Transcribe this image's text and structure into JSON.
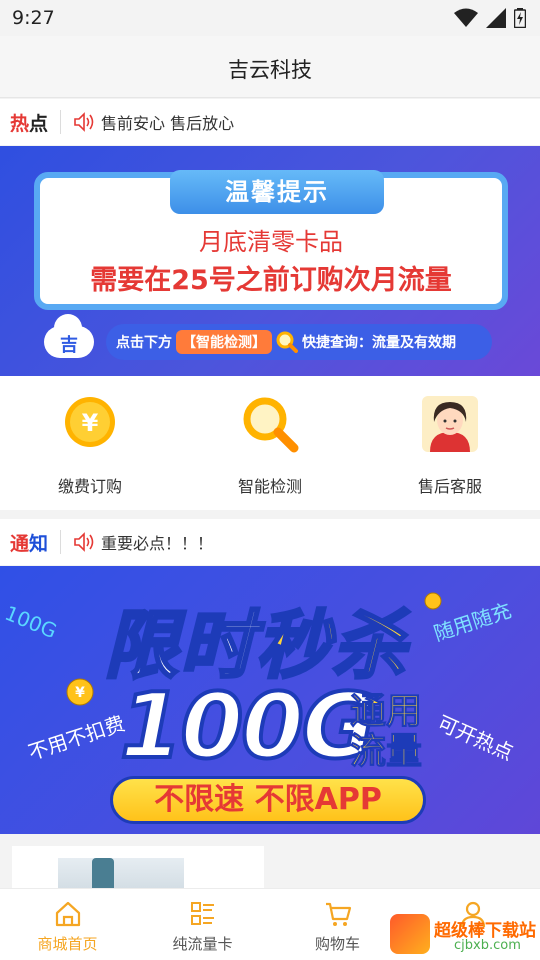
{
  "status_bar": {
    "time": "9:27"
  },
  "app_bar": {
    "title": "吉云科技"
  },
  "hot_ticker": {
    "tag_part1": "热",
    "tag_part2": "点",
    "message": "售前安心 售后放心"
  },
  "banner_notice": {
    "header": "温馨提示",
    "line1": "月底清零卡品",
    "line2": "需要在25号之前订购次月流量",
    "logo_char": "吉",
    "tip_prefix": "点击下方",
    "tip_highlight": "【智能检测】",
    "tip_suffix": "快捷查询：流量及有效期"
  },
  "quick_actions": [
    {
      "label": "缴费订购",
      "icon": "yuan-coin-icon"
    },
    {
      "label": "智能检测",
      "icon": "magnifier-icon"
    },
    {
      "label": "售后客服",
      "icon": "customer-service-avatar-icon"
    }
  ],
  "notice_ticker": {
    "tag_part1": "通",
    "tag_part2": "知",
    "message": "重要必点！！！"
  },
  "banner_promo": {
    "title_part1": "限时",
    "title_part2": "秒杀",
    "big_text": "100G",
    "side_line1": "通用",
    "side_line2": "流量",
    "bottom_text": "不限速 不限APP",
    "deco_left": "不用不扣费",
    "deco_right": "可开热点",
    "deco_top_right": "随用随充",
    "deco_top_left": "100G"
  },
  "tab_bar": [
    {
      "label": "商城首页",
      "icon": "home-icon",
      "active": true
    },
    {
      "label": "纯流量卡",
      "icon": "list-icon",
      "active": false
    },
    {
      "label": "购物车",
      "icon": "cart-icon",
      "active": false
    },
    {
      "label": "",
      "icon": "user-icon",
      "active": false
    }
  ],
  "watermark": {
    "title": "超级棒下载站",
    "sub": "cjbxb.com"
  },
  "colors": {
    "accent": "#f5a623",
    "hot_red": "#e53935",
    "notice_blue": "#1e4fd8",
    "banner_blue": "#3f56e0"
  }
}
